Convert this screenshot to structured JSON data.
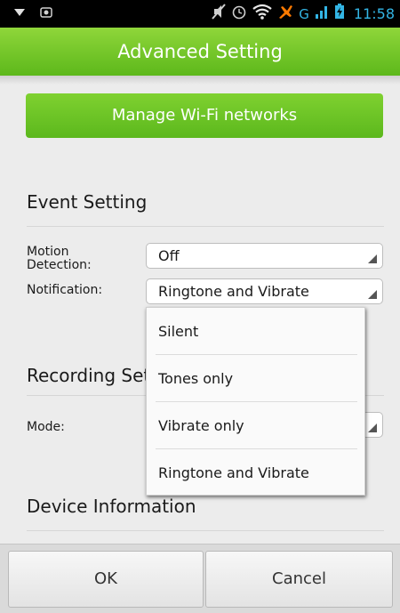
{
  "status_bar": {
    "left_icons": [
      "download-icon",
      "screenshot-icon"
    ],
    "right_icons": [
      "mute-icon",
      "alarm-icon",
      "wifi-icon",
      "airplane-icon",
      "signal-icon",
      "battery-icon"
    ],
    "network": "G",
    "time": "11:58"
  },
  "header": {
    "title": "Advanced Setting"
  },
  "wifi_button": {
    "label": "Manage Wi-Fi networks"
  },
  "event_setting": {
    "title": "Event Setting",
    "motion_label": "Motion\nDetection:",
    "motion_value": "Off",
    "notification_label": "Notification:",
    "notification_value": "Ringtone and Vibrate"
  },
  "recording_setting": {
    "title": "Recording Setting",
    "mode_label": "Mode:"
  },
  "device_information": {
    "title": "Device Information"
  },
  "dropdown": {
    "options": [
      "Silent",
      "Tones only",
      "Vibrate only",
      "Ringtone and Vibrate"
    ]
  },
  "footer": {
    "ok_label": "OK",
    "cancel_label": "Cancel"
  }
}
